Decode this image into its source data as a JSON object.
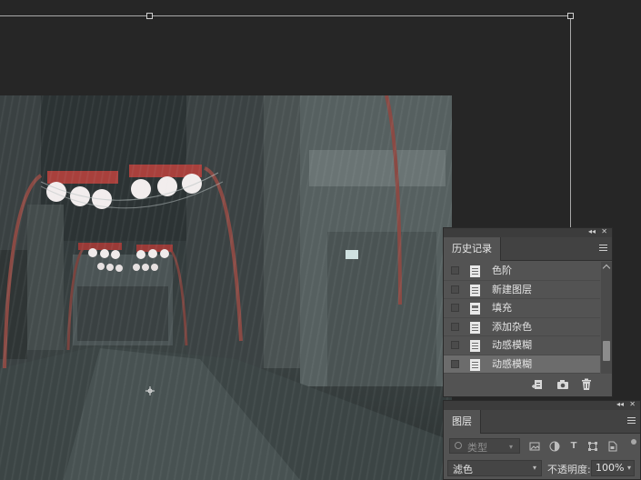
{
  "history_panel": {
    "tab": "历史记录",
    "items": [
      {
        "label": "色阶",
        "icon": "document-icon",
        "selected": false
      },
      {
        "label": "新建图层",
        "icon": "document-icon",
        "selected": false
      },
      {
        "label": "填充",
        "icon": "fill-document-icon",
        "selected": false
      },
      {
        "label": "添加杂色",
        "icon": "document-icon",
        "selected": false
      },
      {
        "label": "动感模糊",
        "icon": "document-icon",
        "selected": false
      },
      {
        "label": "动感模糊",
        "icon": "document-icon",
        "selected": true
      }
    ],
    "footer_icons": [
      "new-document-from-state-icon",
      "camera-icon",
      "trash-icon"
    ]
  },
  "layers_panel": {
    "tab": "图层",
    "filter_label": "类型",
    "filter_icons": [
      "pixel-filter-icon",
      "adjustment-filter-icon",
      "type-filter-icon",
      "shape-filter-icon",
      "smart-object-filter-icon"
    ],
    "blend_mode": "滤色",
    "opacity_label": "不透明度:",
    "opacity_value": "100%"
  },
  "colors": {
    "workspace_bg": "#262626",
    "panel_bg": "#535353",
    "selected_row": "#6c6c6c"
  }
}
